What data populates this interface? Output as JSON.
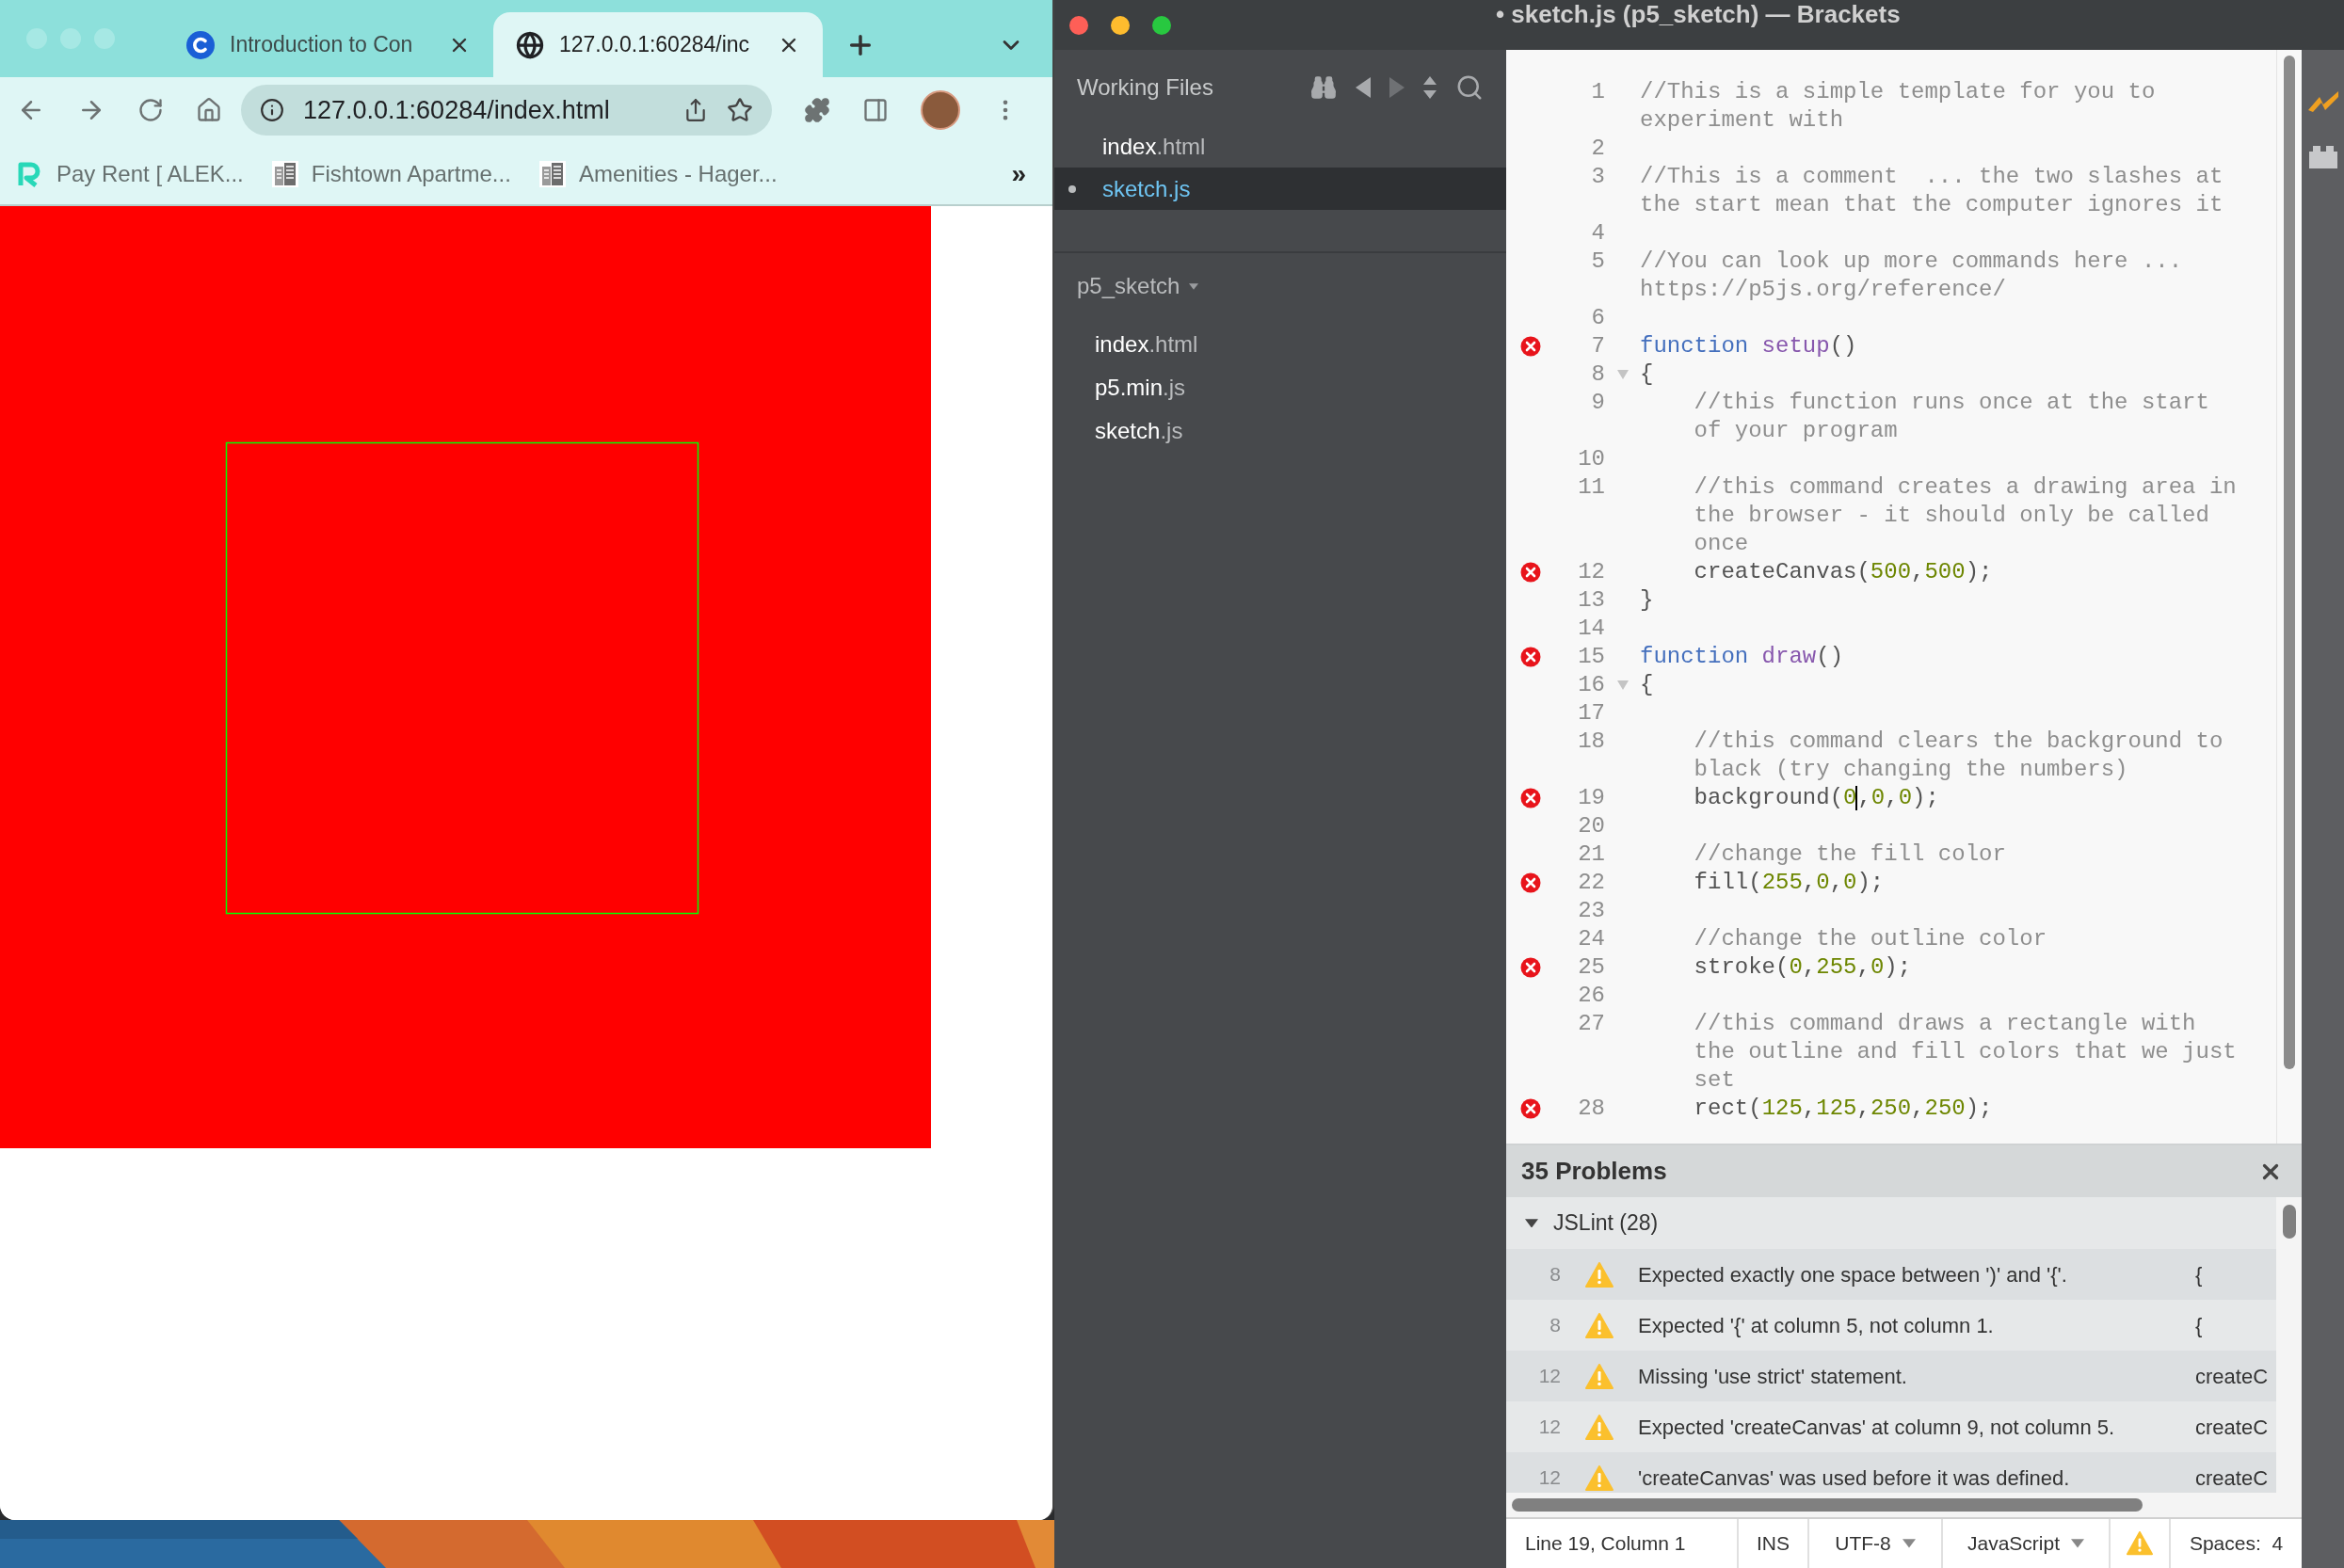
{
  "browser": {
    "tabs": [
      {
        "title": "Introduction to Con",
        "kind": "course",
        "selected": false
      },
      {
        "title": "127.0.0.1:60284/inc",
        "kind": "web",
        "selected": true
      }
    ],
    "address": "127.0.0.1:60284/index.html",
    "bookmarks": [
      {
        "label": "Pay Rent [ ALEK...",
        "kind": "app"
      },
      {
        "label": "Fishtown Apartme...",
        "kind": "site"
      },
      {
        "label": "Amenities - Hager...",
        "kind": "site"
      }
    ],
    "bookmarks_overflow": "»"
  },
  "editor": {
    "title": "• sketch.js (p5_sketch) — Brackets",
    "working_files_label": "Working Files",
    "working_files": [
      {
        "name": "index",
        "ext": ".html",
        "selected": false,
        "modified": false
      },
      {
        "name": "sketch",
        "ext": ".js",
        "selected": true,
        "modified": true
      }
    ],
    "project": {
      "name": "p5_sketch",
      "files": [
        {
          "name": "index",
          "ext": ".html"
        },
        {
          "name": "p5.min",
          "ext": ".js"
        },
        {
          "name": "sketch",
          "ext": ".js"
        }
      ]
    },
    "lines": [
      {
        "n": "1",
        "error": false,
        "fold": false,
        "tokens": [
          {
            "kind": "comment",
            "text": "//This is a simple template for you to experiment with"
          }
        ]
      },
      {
        "n": "2",
        "error": false,
        "fold": false
      },
      {
        "n": "3",
        "error": false,
        "fold": false,
        "tokens": [
          {
            "kind": "comment",
            "text": "//This is a comment  ... the two slashes at the start mean that the computer ignores it"
          }
        ]
      },
      {
        "n": "4",
        "error": false,
        "fold": false
      },
      {
        "n": "5",
        "error": false,
        "fold": false,
        "tokens": [
          {
            "kind": "comment",
            "text": "//You can look up more commands here ... https://p5js.org/reference/"
          }
        ]
      },
      {
        "n": "6",
        "error": false,
        "fold": false
      },
      {
        "n": "7",
        "error": true,
        "fold": false,
        "tokens": [
          {
            "kind": "keyword",
            "text": "function"
          },
          {
            "kind": "def",
            "text": " setup"
          },
          {
            "kind": "plain",
            "text": "()"
          }
        ]
      },
      {
        "n": "8",
        "error": false,
        "fold": true,
        "tokens": [
          {
            "kind": "plain",
            "text": "{"
          }
        ]
      },
      {
        "n": "9",
        "error": false,
        "fold": false,
        "tokens": [
          {
            "kind": "comment",
            "text": "    //this function runs once at the start of your program"
          }
        ]
      },
      {
        "n": "10",
        "error": false,
        "fold": false
      },
      {
        "n": "11",
        "error": false,
        "fold": false,
        "tokens": [
          {
            "kind": "comment",
            "text": "    //this command creates a drawing area in the browser - it should only be called once"
          }
        ]
      },
      {
        "n": "12",
        "error": true,
        "fold": false,
        "tokens": [
          {
            "kind": "plain",
            "text": "    createCanvas("
          },
          {
            "kind": "number",
            "text": "500"
          },
          {
            "kind": "plain",
            "text": ","
          },
          {
            "kind": "number",
            "text": "500"
          },
          {
            "kind": "plain",
            "text": ");"
          }
        ]
      },
      {
        "n": "13",
        "error": false,
        "fold": false,
        "tokens": [
          {
            "kind": "plain",
            "text": "}"
          }
        ]
      },
      {
        "n": "14",
        "error": false,
        "fold": false
      },
      {
        "n": "15",
        "error": true,
        "fold": false,
        "tokens": [
          {
            "kind": "keyword",
            "text": "function"
          },
          {
            "kind": "def",
            "text": " draw"
          },
          {
            "kind": "plain",
            "text": "()"
          }
        ]
      },
      {
        "n": "16",
        "error": false,
        "fold": true,
        "tokens": [
          {
            "kind": "plain",
            "text": "{"
          }
        ]
      },
      {
        "n": "17",
        "error": false,
        "fold": false
      },
      {
        "n": "18",
        "error": false,
        "fold": false,
        "tokens": [
          {
            "kind": "comment",
            "text": "    //this command clears the background to black (try changing the numbers)"
          }
        ]
      },
      {
        "n": "19",
        "error": true,
        "fold": false,
        "tokens": [
          {
            "kind": "plain",
            "text": "    background("
          },
          {
            "kind": "number",
            "text": "0",
            "cursor": true
          },
          {
            "kind": "plain",
            "text": ","
          },
          {
            "kind": "number",
            "text": "0"
          },
          {
            "kind": "plain",
            "text": ","
          },
          {
            "kind": "number",
            "text": "0"
          },
          {
            "kind": "plain",
            "text": ");"
          }
        ]
      },
      {
        "n": "20",
        "error": false,
        "fold": false
      },
      {
        "n": "21",
        "error": false,
        "fold": false,
        "tokens": [
          {
            "kind": "comment",
            "text": "    //change the fill color"
          }
        ]
      },
      {
        "n": "22",
        "error": true,
        "fold": false,
        "tokens": [
          {
            "kind": "plain",
            "text": "    fill("
          },
          {
            "kind": "number",
            "text": "255"
          },
          {
            "kind": "plain",
            "text": ","
          },
          {
            "kind": "number",
            "text": "0"
          },
          {
            "kind": "plain",
            "text": ","
          },
          {
            "kind": "number",
            "text": "0"
          },
          {
            "kind": "plain",
            "text": ");"
          }
        ]
      },
      {
        "n": "23",
        "error": false,
        "fold": false
      },
      {
        "n": "24",
        "error": false,
        "fold": false,
        "tokens": [
          {
            "kind": "comment",
            "text": "    //change the outline color"
          }
        ]
      },
      {
        "n": "25",
        "error": true,
        "fold": false,
        "tokens": [
          {
            "kind": "plain",
            "text": "    stroke("
          },
          {
            "kind": "number",
            "text": "0"
          },
          {
            "kind": "plain",
            "text": ","
          },
          {
            "kind": "number",
            "text": "255"
          },
          {
            "kind": "plain",
            "text": ","
          },
          {
            "kind": "number",
            "text": "0"
          },
          {
            "kind": "plain",
            "text": ");"
          }
        ]
      },
      {
        "n": "26",
        "error": false,
        "fold": false
      },
      {
        "n": "27",
        "error": false,
        "fold": false,
        "tokens": [
          {
            "kind": "comment",
            "text": "    //this command draws a rectangle with the outline and fill colors that we just set"
          }
        ]
      },
      {
        "n": "28",
        "error": true,
        "fold": false,
        "tokens": [
          {
            "kind": "plain",
            "text": "    rect("
          },
          {
            "kind": "number",
            "text": "125"
          },
          {
            "kind": "plain",
            "text": ","
          },
          {
            "kind": "number",
            "text": "125"
          },
          {
            "kind": "plain",
            "text": ","
          },
          {
            "kind": "number",
            "text": "250"
          },
          {
            "kind": "plain",
            "text": ","
          },
          {
            "kind": "number",
            "text": "250"
          },
          {
            "kind": "plain",
            "text": ");"
          }
        ]
      }
    ],
    "problems": {
      "title": "35 Problems",
      "group": {
        "label": "JSLint (28)",
        "expanded": true
      },
      "rows": [
        {
          "line": "8",
          "message": "Expected exactly one space between ')' and '{'.",
          "code": "{"
        },
        {
          "line": "8",
          "message": "Expected '{' at column 5, not column 1.",
          "code": "{"
        },
        {
          "line": "12",
          "message": "Missing 'use strict' statement.",
          "code": "createC"
        },
        {
          "line": "12",
          "message": "Expected 'createCanvas' at column 9, not column 5.",
          "code": "createC"
        },
        {
          "line": "12",
          "message": "'createCanvas' was used before it was defined.",
          "code": "createC"
        }
      ]
    },
    "status": {
      "position": "Line 19, Column 1",
      "mode": "INS",
      "encoding": "UTF-8",
      "language": "JavaScript",
      "indent": "Spaces:  4"
    }
  }
}
